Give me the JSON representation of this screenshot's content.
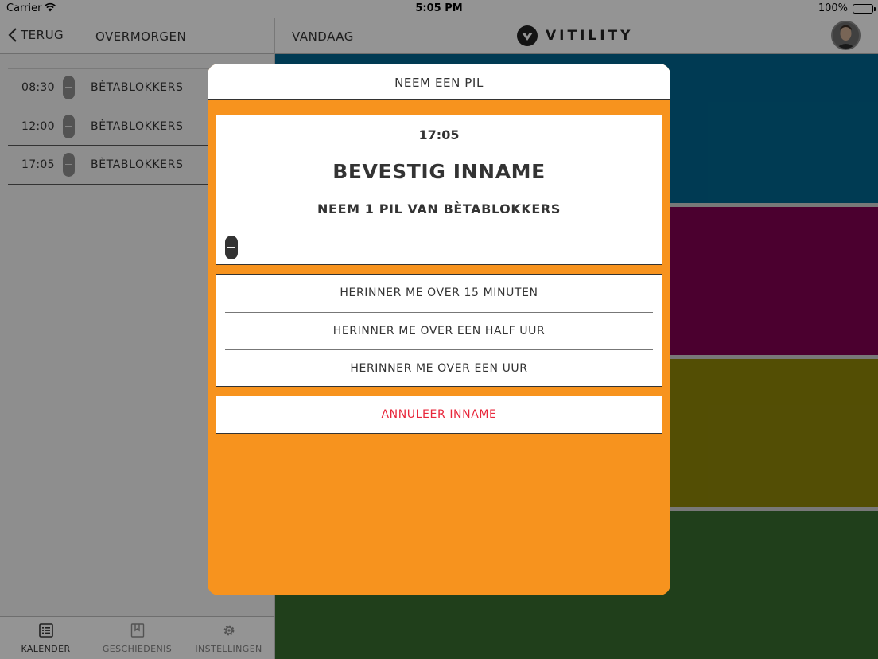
{
  "status_bar": {
    "carrier": "Carrier",
    "time": "5:05 PM",
    "battery": "100%"
  },
  "nav": {
    "back_label": "TERUG",
    "left_title": "OVERMORGEN",
    "right_title": "VANDAAG",
    "logo_text": "VITILITY"
  },
  "medications": [
    {
      "time": "08:30",
      "name": "BÈTABLOKKERS"
    },
    {
      "time": "12:00",
      "name": "BÈTABLOKKERS"
    },
    {
      "time": "17:05",
      "name": "BÈTABLOKKERS"
    }
  ],
  "tabs": [
    {
      "label": "KALENDER",
      "icon": "calendar-list-icon",
      "active": true
    },
    {
      "label": "GESCHIEDENIS",
      "icon": "history-icon",
      "active": false
    },
    {
      "label": "INSTELLINGEN",
      "icon": "gear-icon",
      "active": false
    }
  ],
  "colors": {
    "accent_orange": "#f7931e",
    "block_blue": "#00628a",
    "block_magenta": "#7e004f",
    "block_olive": "#8a8208",
    "block_green": "#36692d",
    "cancel_red": "#e8273b"
  },
  "modal": {
    "title": "NEEM EEN PIL",
    "time": "17:05",
    "heading": "BEVESTIG INNAME",
    "subheading": "NEEM 1 PIL VAN BÈTABLOKKERS",
    "options": [
      "HERINNER ME OVER 15 MINUTEN",
      "HERINNER ME OVER EEN HALF UUR",
      "HERINNER ME OVER EEN UUR"
    ],
    "cancel_label": "ANNULEER INNAME"
  }
}
